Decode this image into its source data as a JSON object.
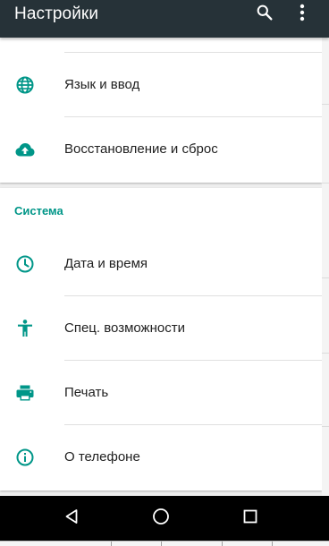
{
  "toolbar": {
    "title": "Настройки",
    "search_icon": "search-icon",
    "more_icon": "more-vert-icon",
    "background": "#263238"
  },
  "accent_color": "#009688",
  "sections": [
    {
      "items": [
        {
          "label": "Язык и ввод",
          "icon": "globe-icon"
        },
        {
          "label": "Восстановление и сброс",
          "icon": "cloud-upload-icon"
        }
      ]
    },
    {
      "header": "Система",
      "items": [
        {
          "label": "Дата и время",
          "icon": "clock-icon"
        },
        {
          "label": "Спец. возможности",
          "icon": "accessibility-icon"
        },
        {
          "label": "Печать",
          "icon": "print-icon"
        },
        {
          "label": "О телефоне",
          "icon": "info-icon"
        }
      ]
    }
  ],
  "navbar": {
    "back_icon": "back-triangle-icon",
    "home_icon": "home-circle-icon",
    "recent_icon": "recent-apps-icon"
  }
}
